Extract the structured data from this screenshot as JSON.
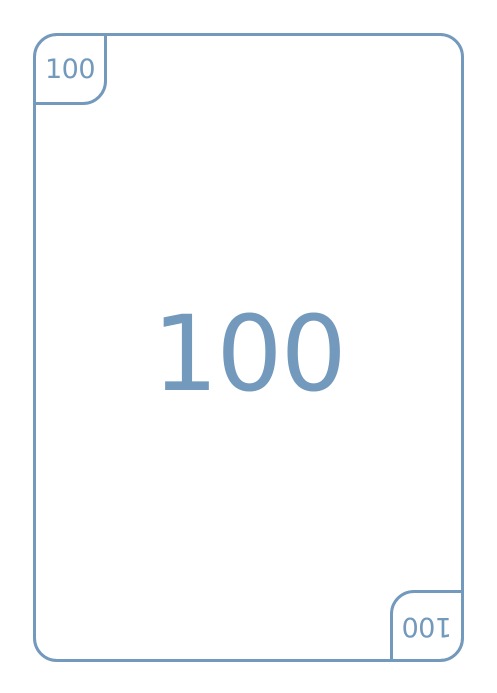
{
  "card": {
    "value": "100",
    "corner_top_left": "100",
    "corner_bottom_right": "100",
    "accent_color": "#7399bc"
  }
}
